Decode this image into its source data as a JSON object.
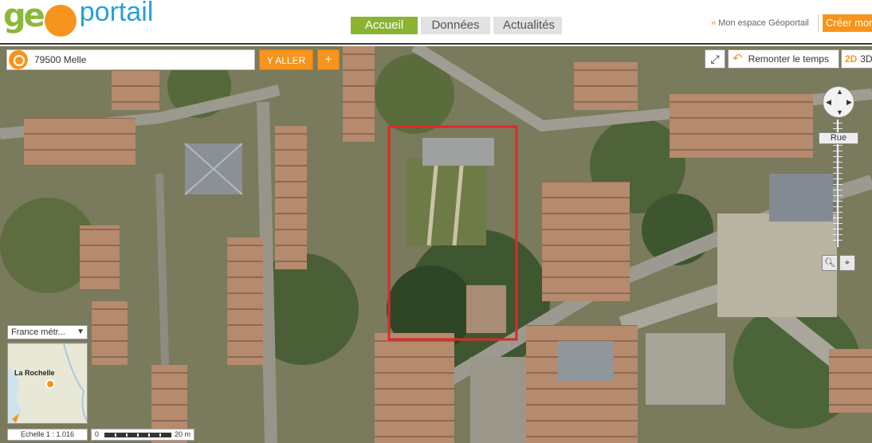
{
  "logo": {
    "geo_prefix": "ge",
    "geo_suffix": "o",
    "portail": "portail"
  },
  "nav": {
    "tabs": [
      {
        "label": "Accueil",
        "active": true
      },
      {
        "label": "Données",
        "active": false
      },
      {
        "label": "Actualités",
        "active": false
      }
    ],
    "espace": "Mon espace Géoportail",
    "creer": "Créer mon"
  },
  "search": {
    "value": "79500 Melle",
    "go_label": "Y ALLER",
    "plus_label": "+"
  },
  "controls": {
    "remonter": "Remonter le temps",
    "mode_2d": "2D",
    "mode_3d": "3D",
    "rue": "Rue"
  },
  "territory": {
    "label": "France métr..."
  },
  "minimap": {
    "city": "La Rochelle"
  },
  "scale": {
    "echelle": "Echelle 1 :  1.016",
    "zero": "0",
    "distance": "20 m"
  },
  "colors": {
    "accent_orange": "#f7941d",
    "active_tab": "#8bb332",
    "highlight_red": "#e0282a"
  }
}
